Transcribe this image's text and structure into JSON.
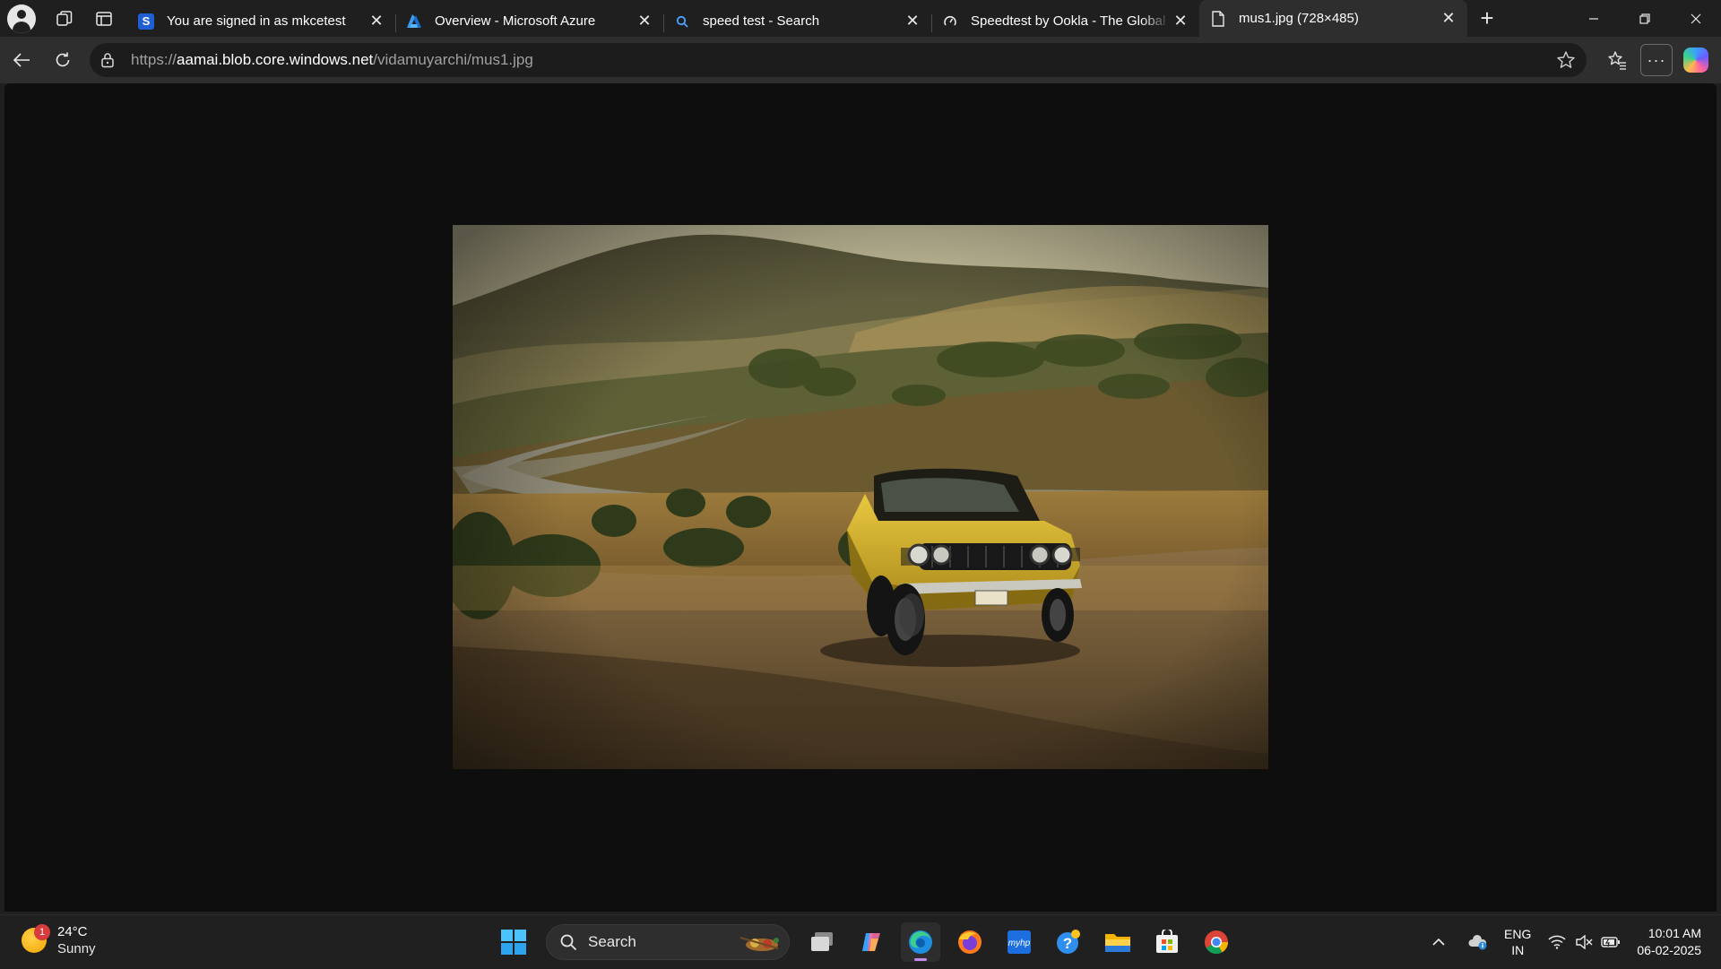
{
  "browser": {
    "tabs": [
      {
        "title": "You are signed in as mkcetest",
        "icon": "s-square-icon",
        "active": false
      },
      {
        "title": "Overview - Microsoft Azure",
        "icon": "azure-icon",
        "active": false
      },
      {
        "title": "speed test - Search",
        "icon": "search-icon",
        "active": false
      },
      {
        "title": "Speedtest by Ookla - The Global Broadband Speed Test",
        "icon": "speedometer-icon",
        "active": false
      },
      {
        "title": "mus1.jpg (728×485)",
        "icon": "document-icon",
        "active": true
      }
    ],
    "favicon_letter": "S",
    "address": {
      "scheme": "https://",
      "host": "aamai.blob.core.windows.net",
      "path": "/vidamuyarchi/mus1.jpg"
    }
  },
  "content": {
    "image_subject": "yellow muscle car on dirt road with winding road and hills"
  },
  "taskbar": {
    "weather": {
      "temp": "24°C",
      "condition": "Sunny",
      "badge": "1"
    },
    "search_placeholder": "Search",
    "language": {
      "line1": "ENG",
      "line2": "IN"
    },
    "clock": {
      "time": "10:01 AM",
      "date": "06-02-2025"
    }
  },
  "colors": {
    "accent_running": "#c58cf0",
    "car_yellow": "#d6b325"
  }
}
